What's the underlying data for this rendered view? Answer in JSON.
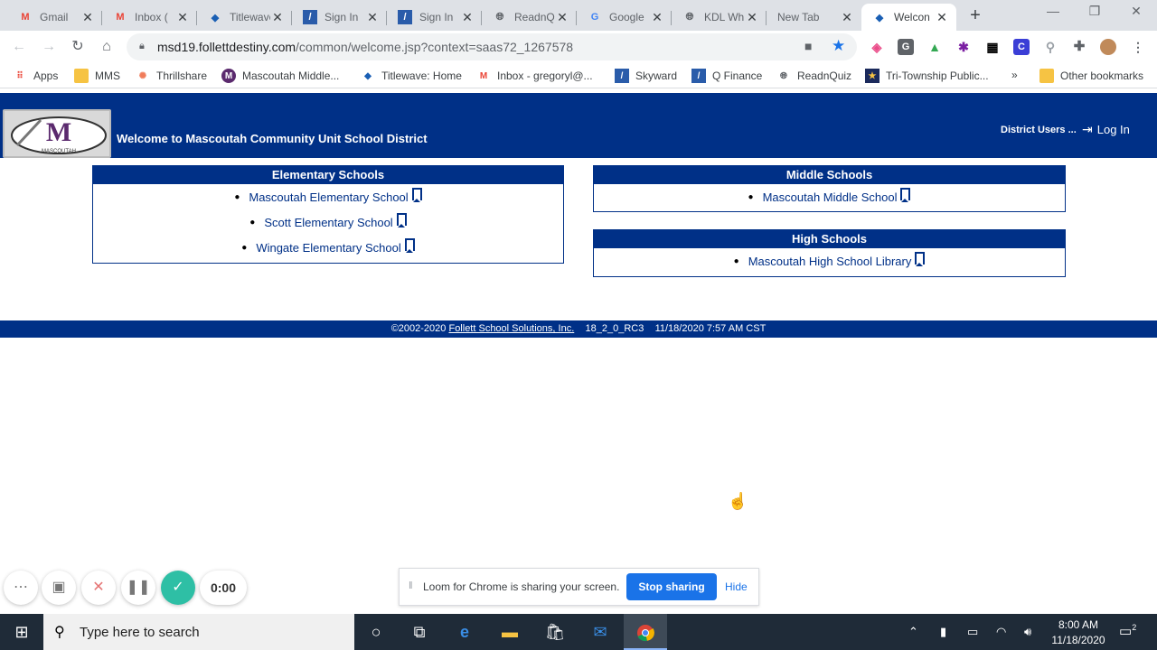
{
  "tabs": [
    {
      "title": "Gmail",
      "icon": "gmail-icon"
    },
    {
      "title": "Inbox (",
      "icon": "gmail-icon"
    },
    {
      "title": "Titlewave",
      "icon": "titlewave-icon"
    },
    {
      "title": "Sign In",
      "icon": "skyward-icon"
    },
    {
      "title": "Sign In",
      "icon": "skyward-icon"
    },
    {
      "title": "ReadnQ",
      "icon": "globe-icon"
    },
    {
      "title": "Google",
      "icon": "google-icon"
    },
    {
      "title": "KDL Wh",
      "icon": "globe-icon"
    },
    {
      "title": "New Tab",
      "icon": ""
    },
    {
      "title": "Welcon",
      "icon": "titlewave-icon"
    }
  ],
  "toolbar": {
    "url_host": "msd19.follettdestiny.com",
    "url_path": "/common/welcome.jsp?context=saas72_1267578"
  },
  "bookmarks": [
    {
      "label": "Apps"
    },
    {
      "label": "MMS"
    },
    {
      "label": "Thrillshare"
    },
    {
      "label": "Mascoutah Middle..."
    },
    {
      "label": "Titlewave: Home"
    },
    {
      "label": "Inbox - gregoryl@..."
    },
    {
      "label": "Skyward"
    },
    {
      "label": "Q Finance"
    },
    {
      "label": "ReadnQuiz"
    },
    {
      "label": "Tri-Township Public..."
    },
    {
      "label": "»"
    },
    {
      "label": "Other bookmarks"
    }
  ],
  "header": {
    "logo_text": "MASCOUTAH",
    "welcome": "Welcome to Mascoutah Community Unit School District",
    "district_users": "District Users ...",
    "login": "Log In"
  },
  "sections": {
    "elementary": {
      "title": "Elementary Schools",
      "schools": [
        "Mascoutah Elementary School",
        "Scott Elementary School",
        "Wingate Elementary School"
      ]
    },
    "middle": {
      "title": "Middle Schools",
      "schools": [
        "Mascoutah Middle School"
      ]
    },
    "high": {
      "title": "High Schools",
      "schools": [
        "Mascoutah High School Library"
      ]
    }
  },
  "footer": {
    "copyright": "©2002-2020",
    "company": "Follett School Solutions, Inc.",
    "version": "18_2_0_RC3",
    "datetime": "11/18/2020 7:57 AM CST"
  },
  "loom": {
    "timer": "0:00",
    "message": "Loom for Chrome is sharing your screen.",
    "stop": "Stop sharing",
    "hide": "Hide"
  },
  "taskbar": {
    "search_placeholder": "Type here to search",
    "time": "8:00 AM",
    "date": "11/18/2020",
    "notifications": "2"
  },
  "colors": {
    "brand_blue": "#003087",
    "loom_green": "#2ebfa5",
    "chrome_blue": "#1a73e8"
  }
}
